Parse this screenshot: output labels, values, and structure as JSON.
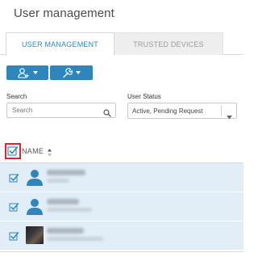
{
  "page": {
    "title": "User management"
  },
  "tabs": [
    {
      "label": "USER MANAGEMENT",
      "active": true
    },
    {
      "label": "TRUSTED DEVICES",
      "active": false
    }
  ],
  "toolbar": {
    "add_user_icon": "add-user-icon",
    "tools_icon": "wrench-icon",
    "accent_color": "#2f86bd"
  },
  "filters": {
    "search_label": "Search",
    "search_placeholder": "Search",
    "status_label": "User Status",
    "status_value": "Active, Pending Request"
  },
  "table": {
    "header_name": "NAME",
    "select_all_checked": true,
    "rows": [
      {
        "checked": true,
        "avatar": "default-avatar"
      },
      {
        "checked": true,
        "avatar": "default-avatar"
      },
      {
        "checked": true,
        "avatar": "photo-avatar"
      }
    ]
  }
}
